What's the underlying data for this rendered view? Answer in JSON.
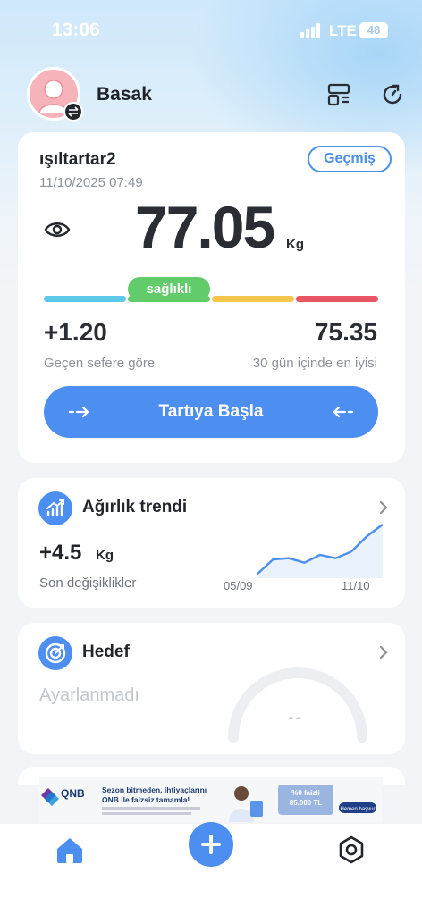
{
  "status_bar": {
    "time": "13:06",
    "network": "LTE",
    "battery": "48"
  },
  "header": {
    "username": "Basak",
    "icons": [
      "dashboard-icon",
      "refresh-icon"
    ]
  },
  "main_card": {
    "device_name": "ışıltartar2",
    "datetime": "11/10/2025 07:49",
    "history_label": "Geçmiş",
    "weight": "77.05",
    "unit": "Kg",
    "status_label": "sağlıklı",
    "scale_colors": [
      "#5cc8ea",
      "#62cc6b",
      "#f3c54a",
      "#e85565"
    ],
    "change_value": "+1.20",
    "change_label": "Geçen sefere göre",
    "best_value": "75.35",
    "best_label": "30 gün içinde en iyisi",
    "start_label": "Tartıya Başla"
  },
  "trend_card": {
    "title": "Ağırlık trendi",
    "delta": "+4.5",
    "delta_unit": "Kg",
    "delta_label": "Son değişiklikler",
    "x_start": "05/09",
    "x_end": "11/10",
    "chart_data": {
      "type": "area",
      "x": [
        "05/09",
        "11/10"
      ],
      "series": [
        {
          "values": [
            72.6,
            73.9,
            74.0,
            73.6,
            74.3,
            74.0,
            74.6,
            76.0,
            77.05
          ]
        }
      ]
    }
  },
  "goal_card": {
    "title": "Hedef",
    "status": "Ayarlanmadı",
    "gauge_value": "--"
  },
  "ad": {
    "brand": "QNB",
    "headline": "Sezon bitmeden, ihtiyaçlarını ONB ile faizsiz tamamla!",
    "offer": "%0 faizli 85.000 TL",
    "cta": "Hemen başvur"
  },
  "bottom_nav": {
    "items": [
      "home-icon",
      "add-icon",
      "settings-icon"
    ]
  },
  "colors": {
    "accent": "#4d8ff0",
    "healthy": "#62cc6b"
  }
}
